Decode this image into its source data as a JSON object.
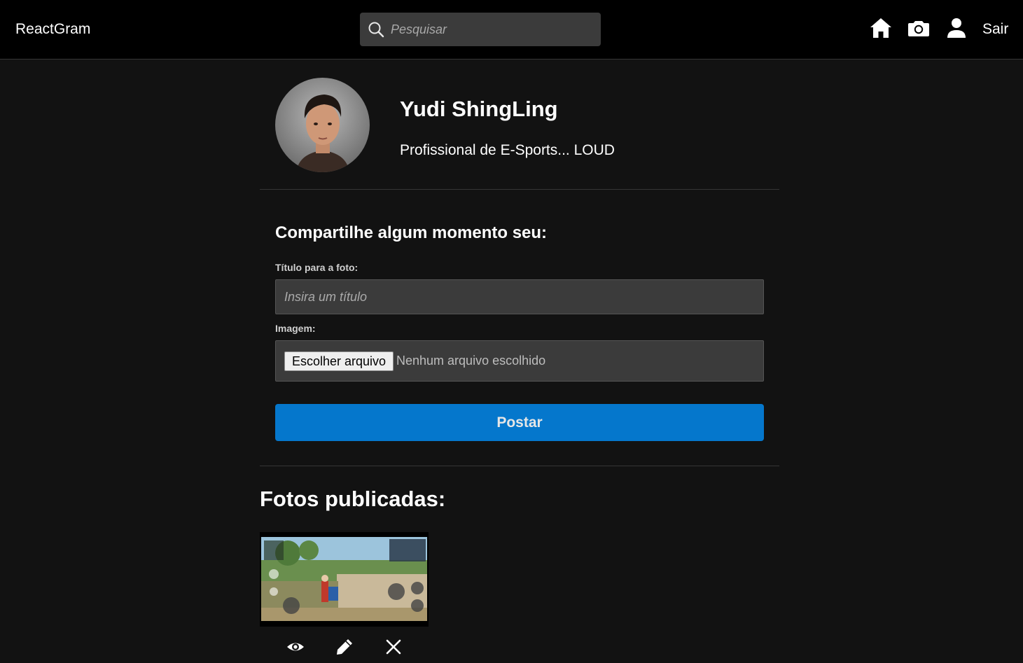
{
  "navbar": {
    "brand": "ReactGram",
    "search_placeholder": "Pesquisar",
    "home_icon": "home-icon",
    "camera_icon": "camera-icon",
    "profile_icon": "user-icon",
    "logout_label": "Sair"
  },
  "profile": {
    "name": "Yudi ShingLing",
    "bio": "Profissional de E-Sports... LOUD"
  },
  "new_photo": {
    "heading": "Compartilhe algum momento seu:",
    "title_label": "Título para a foto:",
    "title_placeholder": "Insira um título",
    "image_label": "Imagem:",
    "file_button_label": "Escolher arquivo",
    "file_status": "Nenhum arquivo escolhido",
    "submit_label": "Postar"
  },
  "photos": {
    "heading": "Fotos publicadas:",
    "items": [
      {
        "thumbnail": "game-screenshot",
        "actions": [
          "view-icon",
          "edit-icon",
          "delete-icon"
        ]
      }
    ]
  },
  "colors": {
    "background": "#121212",
    "navbar": "#000000",
    "input": "#3b3b3b",
    "accent": "#0577cc"
  }
}
